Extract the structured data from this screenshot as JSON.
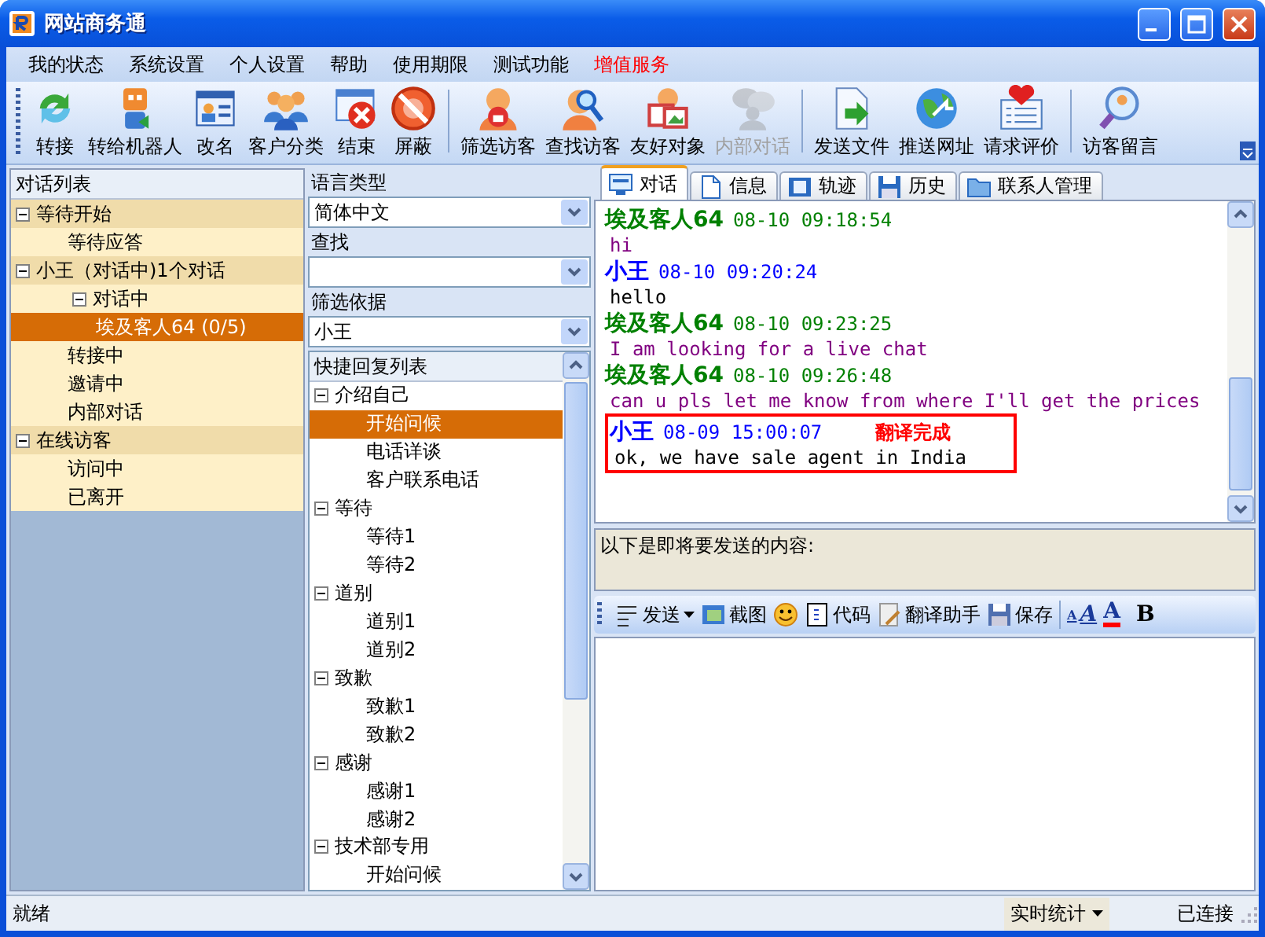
{
  "window": {
    "title": "网站商务通"
  },
  "menu": [
    {
      "label": "我的状态",
      "color": "#000000"
    },
    {
      "label": "系统设置",
      "color": "#000000"
    },
    {
      "label": "个人设置",
      "color": "#000000"
    },
    {
      "label": "帮助",
      "color": "#000000"
    },
    {
      "label": "使用期限",
      "color": "#000000"
    },
    {
      "label": "测试功能",
      "color": "#000000"
    },
    {
      "label": "增值服务",
      "color": "#ff0000"
    }
  ],
  "toolbar": {
    "groups": [
      {
        "buttons": [
          {
            "kind": "transfer",
            "label": "转接",
            "disabled": false
          },
          {
            "kind": "robot",
            "label": "转给机器人",
            "disabled": false
          },
          {
            "kind": "rename",
            "label": "改名",
            "disabled": false
          },
          {
            "kind": "classify",
            "label": "客户分类",
            "disabled": false
          },
          {
            "kind": "end",
            "label": "结束",
            "disabled": false
          },
          {
            "kind": "block",
            "label": "屏蔽",
            "disabled": false
          }
        ]
      },
      {
        "buttons": [
          {
            "kind": "filter",
            "label": "筛选访客",
            "disabled": false
          },
          {
            "kind": "find",
            "label": "查找访客",
            "disabled": false
          },
          {
            "kind": "friend",
            "label": "友好对象",
            "disabled": false
          },
          {
            "kind": "internal",
            "label": "内部对话",
            "disabled": true
          }
        ]
      },
      {
        "buttons": [
          {
            "kind": "send_file",
            "label": "发送文件",
            "disabled": false
          },
          {
            "kind": "push_url",
            "label": "推送网址",
            "disabled": false
          },
          {
            "kind": "rate",
            "label": "请求评价",
            "disabled": false
          }
        ]
      },
      {
        "buttons": [
          {
            "kind": "message",
            "label": "访客留言",
            "disabled": false
          }
        ]
      }
    ]
  },
  "conversation_list": {
    "header": "对话列表",
    "items": [
      {
        "label": "等待开始",
        "expanded": true,
        "selected": false,
        "children": [
          {
            "label": "等待应答",
            "selected": false
          }
        ]
      },
      {
        "label": "小王（对话中)1个对话",
        "expanded": true,
        "selected": false,
        "children": [
          {
            "label": "对话中",
            "expanded": true,
            "selected": false,
            "children": [
              {
                "label": "埃及客人64 (0/5)",
                "selected": true
              }
            ]
          },
          {
            "label": "转接中",
            "selected": false
          },
          {
            "label": "邀请中",
            "selected": false
          },
          {
            "label": "内部对话",
            "selected": false
          }
        ]
      },
      {
        "label": "在线访客",
        "expanded": true,
        "selected": false,
        "children": [
          {
            "label": "访问中",
            "selected": false
          },
          {
            "label": "已离开",
            "selected": false
          }
        ]
      }
    ]
  },
  "language": {
    "label": "语言类型",
    "value": "简体中文"
  },
  "search": {
    "label": "查找"
  },
  "filter": {
    "label": "筛选依据",
    "value": "小王"
  },
  "quick_replies": {
    "header": "快捷回复列表",
    "items": [
      {
        "label": "介绍自己",
        "expanded": true,
        "selected": false,
        "children": [
          {
            "label": "开始问候",
            "selected": true
          },
          {
            "label": "电话详谈",
            "selected": false
          },
          {
            "label": "客户联系电话",
            "selected": false
          }
        ]
      },
      {
        "label": "等待",
        "expanded": true,
        "selected": false,
        "children": [
          {
            "label": "等待1",
            "selected": false
          },
          {
            "label": "等待2",
            "selected": false
          }
        ]
      },
      {
        "label": "道别",
        "expanded": true,
        "selected": false,
        "children": [
          {
            "label": "道别1",
            "selected": false
          },
          {
            "label": "道别2",
            "selected": false
          }
        ]
      },
      {
        "label": "致歉",
        "expanded": true,
        "selected": false,
        "children": [
          {
            "label": "致歉1",
            "selected": false
          },
          {
            "label": "致歉2",
            "selected": false
          }
        ]
      },
      {
        "label": "感谢",
        "expanded": true,
        "selected": false,
        "children": [
          {
            "label": "感谢1",
            "selected": false
          },
          {
            "label": "感谢2",
            "selected": false
          }
        ]
      },
      {
        "label": "技术部专用",
        "expanded": true,
        "selected": false,
        "children": [
          {
            "label": "开始问候",
            "selected": false
          }
        ]
      }
    ]
  },
  "tabs": [
    {
      "kind": "chat",
      "label": "对话",
      "selected": true
    },
    {
      "kind": "info",
      "label": "信息",
      "selected": false
    },
    {
      "kind": "track",
      "label": "轨迹",
      "selected": false
    },
    {
      "kind": "history",
      "label": "历史",
      "selected": false
    },
    {
      "kind": "contacts",
      "label": "联系人管理",
      "selected": false
    }
  ],
  "messages": [
    {
      "kind": "visitor",
      "sender": "埃及客人64",
      "time": "08-10 09:18:54",
      "text": "hi",
      "highlighted": false
    },
    {
      "kind": "agent",
      "sender": "小王",
      "time": "08-10 09:20:24",
      "text": "hello",
      "highlighted": false
    },
    {
      "kind": "visitor",
      "sender": "埃及客人64",
      "time": "08-10 09:23:25",
      "text": "I am looking for a live chat",
      "highlighted": false
    },
    {
      "kind": "visitor",
      "sender": "埃及客人64",
      "time": "08-10 09:26:48",
      "text": "can u pls let me know from where I'll get the prices",
      "highlighted": false
    },
    {
      "kind": "agent",
      "sender": "小王",
      "time": "08-09 15:00:07",
      "text": "ok, we have sale agent in India",
      "highlighted": true,
      "note": "翻译完成"
    }
  ],
  "compose": {
    "label": "以下是即将要发送的内容:"
  },
  "compose_toolbar": [
    {
      "kind": "send",
      "label": "发送"
    },
    {
      "kind": "screenshot",
      "label": "截图"
    },
    {
      "kind": "emoji"
    },
    {
      "kind": "code",
      "label": "代码"
    },
    {
      "kind": "translate",
      "label": "翻译助手"
    },
    {
      "kind": "save",
      "label": "保存"
    },
    {
      "kind": "separator"
    },
    {
      "kind": "font_size",
      "small": "A",
      "large": "A"
    },
    {
      "kind": "font_color",
      "label": "A"
    },
    {
      "kind": "bold",
      "label": "B"
    }
  ],
  "status_bar": {
    "state": "就绪",
    "stats": "实时统计",
    "connection": "已连接"
  }
}
